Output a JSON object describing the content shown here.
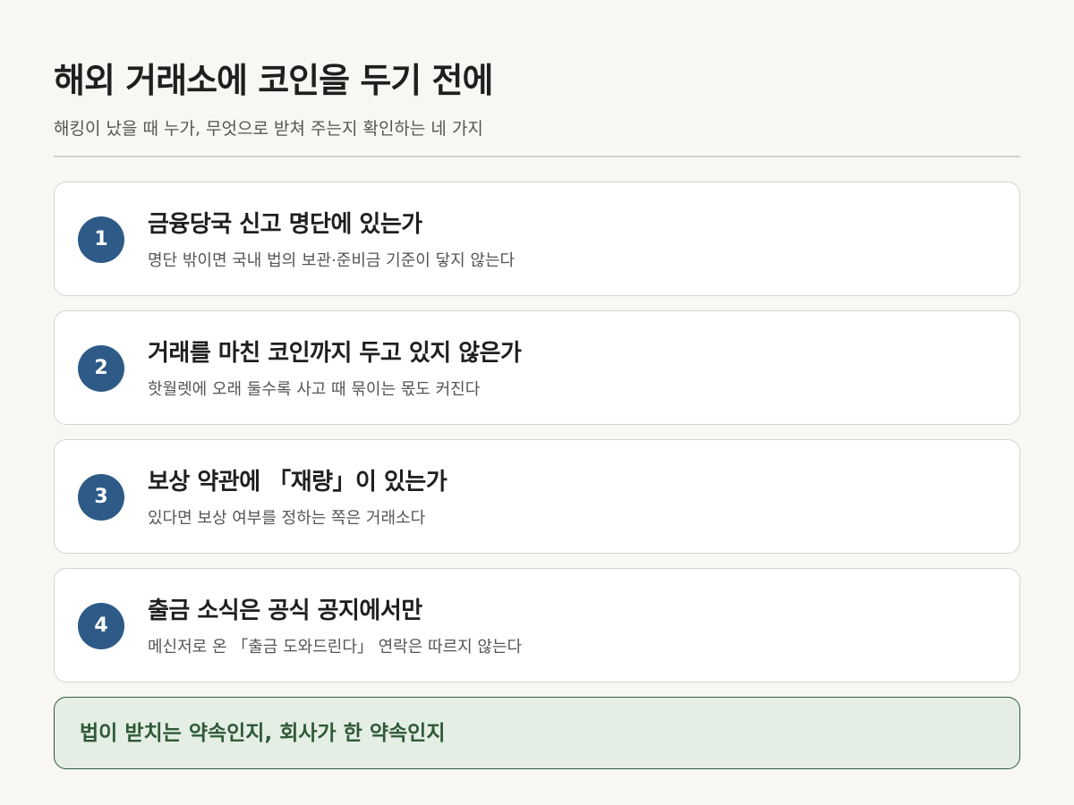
{
  "header": {
    "title": "해외 거래소에 코인을 두기 전에",
    "subtitle": "해킹이 났을 때 누가, 무엇으로 받쳐 주는지 확인하는 네 가지"
  },
  "checklist": [
    {
      "number": "1",
      "title": "금융당국 신고 명단에 있는가",
      "description": "명단 밖이면 국내 법의 보관·준비금 기준이 닿지 않는다"
    },
    {
      "number": "2",
      "title": "거래를 마친 코인까지 두고 있지 않은가",
      "description": "핫월렛에 오래 둘수록 사고 때 묶이는 몫도 커진다"
    },
    {
      "number": "3",
      "title": "보상 약관에 「재량」이 있는가",
      "description": "있다면 보상 여부를 정하는 쪽은 거래소다"
    },
    {
      "number": "4",
      "title": "출금 소식은 공식 공지에서만",
      "description": "메신저로 온 「출금 도와드린다」 연락은 따르지 않는다"
    }
  ],
  "callout": {
    "text": "법이 받치는 약속인지, 회사가 한 약속인지"
  },
  "colors": {
    "background": "#f8f7f3",
    "badge": "#2d5a86",
    "callout_background": "#e4eee4",
    "callout_text": "#2e5a36"
  }
}
